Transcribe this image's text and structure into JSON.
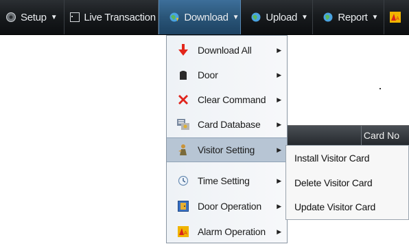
{
  "menubar": {
    "items": [
      {
        "label": "Setup",
        "icon": "gear-icon",
        "has_caret": true
      },
      {
        "label": "Live Transaction",
        "icon": "window-icon",
        "has_caret": false
      },
      {
        "label": "Download",
        "icon": "download-globe-icon",
        "has_caret": true,
        "active": true
      },
      {
        "label": "Upload",
        "icon": "upload-globe-icon",
        "has_caret": true
      },
      {
        "label": "Report",
        "icon": "report-globe-icon",
        "has_caret": true
      },
      {
        "label": "",
        "icon": "alarm-icon",
        "has_caret": false
      }
    ]
  },
  "download_menu": {
    "items": [
      {
        "label": "Download All",
        "icon": "red-down-arrow-icon"
      },
      {
        "label": "Door",
        "icon": "door-icon"
      },
      {
        "label": "Clear Command",
        "icon": "red-x-icon"
      },
      {
        "label": "Card Database",
        "icon": "card-database-icon"
      },
      {
        "label": "Visitor Setting",
        "icon": "visitor-icon",
        "highlighted": true
      },
      {
        "label": "Time Setting",
        "icon": "clock-icon"
      },
      {
        "label": "Door Operation",
        "icon": "door-operation-icon"
      },
      {
        "label": "Alarm Operation",
        "icon": "alarm-operation-icon"
      }
    ]
  },
  "visitor_submenu": {
    "items": [
      {
        "label": "Install Visitor Card"
      },
      {
        "label": "Delete Visitor Card"
      },
      {
        "label": "Update Visitor Card"
      }
    ]
  },
  "table": {
    "column_header": "Card No"
  },
  "colors": {
    "menubar_bg": "#181b1e",
    "active_tab": "#2a5578",
    "highlight": "#b7c5d4"
  }
}
